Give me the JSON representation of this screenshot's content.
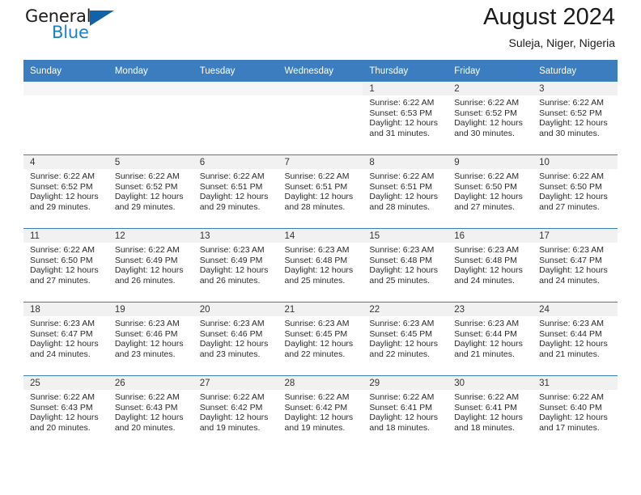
{
  "logo": {
    "primary_text": "General",
    "secondary_text": "Blue",
    "primary_color": "#1b1b1b",
    "secondary_color": "#1f7fc4",
    "triangle_color": "#1162a8"
  },
  "header": {
    "month_title": "August 2024",
    "location": "Suleja, Niger, Nigeria"
  },
  "colors": {
    "header_row_background": "#3b7dbf",
    "header_row_text": "#ffffff",
    "day_number_background": "#f1f1f1",
    "week_separator": "#3b7dbf"
  },
  "weekdays": [
    "Sunday",
    "Monday",
    "Tuesday",
    "Wednesday",
    "Thursday",
    "Friday",
    "Saturday"
  ],
  "weeks": [
    [
      {
        "day": "",
        "sunrise": "",
        "sunset": "",
        "daylight": ""
      },
      {
        "day": "",
        "sunrise": "",
        "sunset": "",
        "daylight": ""
      },
      {
        "day": "",
        "sunrise": "",
        "sunset": "",
        "daylight": ""
      },
      {
        "day": "",
        "sunrise": "",
        "sunset": "",
        "daylight": ""
      },
      {
        "day": "1",
        "sunrise": "Sunrise: 6:22 AM",
        "sunset": "Sunset: 6:53 PM",
        "daylight": "Daylight: 12 hours and 31 minutes."
      },
      {
        "day": "2",
        "sunrise": "Sunrise: 6:22 AM",
        "sunset": "Sunset: 6:52 PM",
        "daylight": "Daylight: 12 hours and 30 minutes."
      },
      {
        "day": "3",
        "sunrise": "Sunrise: 6:22 AM",
        "sunset": "Sunset: 6:52 PM",
        "daylight": "Daylight: 12 hours and 30 minutes."
      }
    ],
    [
      {
        "day": "4",
        "sunrise": "Sunrise: 6:22 AM",
        "sunset": "Sunset: 6:52 PM",
        "daylight": "Daylight: 12 hours and 29 minutes."
      },
      {
        "day": "5",
        "sunrise": "Sunrise: 6:22 AM",
        "sunset": "Sunset: 6:52 PM",
        "daylight": "Daylight: 12 hours and 29 minutes."
      },
      {
        "day": "6",
        "sunrise": "Sunrise: 6:22 AM",
        "sunset": "Sunset: 6:51 PM",
        "daylight": "Daylight: 12 hours and 29 minutes."
      },
      {
        "day": "7",
        "sunrise": "Sunrise: 6:22 AM",
        "sunset": "Sunset: 6:51 PM",
        "daylight": "Daylight: 12 hours and 28 minutes."
      },
      {
        "day": "8",
        "sunrise": "Sunrise: 6:22 AM",
        "sunset": "Sunset: 6:51 PM",
        "daylight": "Daylight: 12 hours and 28 minutes."
      },
      {
        "day": "9",
        "sunrise": "Sunrise: 6:22 AM",
        "sunset": "Sunset: 6:50 PM",
        "daylight": "Daylight: 12 hours and 27 minutes."
      },
      {
        "day": "10",
        "sunrise": "Sunrise: 6:22 AM",
        "sunset": "Sunset: 6:50 PM",
        "daylight": "Daylight: 12 hours and 27 minutes."
      }
    ],
    [
      {
        "day": "11",
        "sunrise": "Sunrise: 6:22 AM",
        "sunset": "Sunset: 6:50 PM",
        "daylight": "Daylight: 12 hours and 27 minutes."
      },
      {
        "day": "12",
        "sunrise": "Sunrise: 6:22 AM",
        "sunset": "Sunset: 6:49 PM",
        "daylight": "Daylight: 12 hours and 26 minutes."
      },
      {
        "day": "13",
        "sunrise": "Sunrise: 6:23 AM",
        "sunset": "Sunset: 6:49 PM",
        "daylight": "Daylight: 12 hours and 26 minutes."
      },
      {
        "day": "14",
        "sunrise": "Sunrise: 6:23 AM",
        "sunset": "Sunset: 6:48 PM",
        "daylight": "Daylight: 12 hours and 25 minutes."
      },
      {
        "day": "15",
        "sunrise": "Sunrise: 6:23 AM",
        "sunset": "Sunset: 6:48 PM",
        "daylight": "Daylight: 12 hours and 25 minutes."
      },
      {
        "day": "16",
        "sunrise": "Sunrise: 6:23 AM",
        "sunset": "Sunset: 6:48 PM",
        "daylight": "Daylight: 12 hours and 24 minutes."
      },
      {
        "day": "17",
        "sunrise": "Sunrise: 6:23 AM",
        "sunset": "Sunset: 6:47 PM",
        "daylight": "Daylight: 12 hours and 24 minutes."
      }
    ],
    [
      {
        "day": "18",
        "sunrise": "Sunrise: 6:23 AM",
        "sunset": "Sunset: 6:47 PM",
        "daylight": "Daylight: 12 hours and 24 minutes."
      },
      {
        "day": "19",
        "sunrise": "Sunrise: 6:23 AM",
        "sunset": "Sunset: 6:46 PM",
        "daylight": "Daylight: 12 hours and 23 minutes."
      },
      {
        "day": "20",
        "sunrise": "Sunrise: 6:23 AM",
        "sunset": "Sunset: 6:46 PM",
        "daylight": "Daylight: 12 hours and 23 minutes."
      },
      {
        "day": "21",
        "sunrise": "Sunrise: 6:23 AM",
        "sunset": "Sunset: 6:45 PM",
        "daylight": "Daylight: 12 hours and 22 minutes."
      },
      {
        "day": "22",
        "sunrise": "Sunrise: 6:23 AM",
        "sunset": "Sunset: 6:45 PM",
        "daylight": "Daylight: 12 hours and 22 minutes."
      },
      {
        "day": "23",
        "sunrise": "Sunrise: 6:23 AM",
        "sunset": "Sunset: 6:44 PM",
        "daylight": "Daylight: 12 hours and 21 minutes."
      },
      {
        "day": "24",
        "sunrise": "Sunrise: 6:23 AM",
        "sunset": "Sunset: 6:44 PM",
        "daylight": "Daylight: 12 hours and 21 minutes."
      }
    ],
    [
      {
        "day": "25",
        "sunrise": "Sunrise: 6:22 AM",
        "sunset": "Sunset: 6:43 PM",
        "daylight": "Daylight: 12 hours and 20 minutes."
      },
      {
        "day": "26",
        "sunrise": "Sunrise: 6:22 AM",
        "sunset": "Sunset: 6:43 PM",
        "daylight": "Daylight: 12 hours and 20 minutes."
      },
      {
        "day": "27",
        "sunrise": "Sunrise: 6:22 AM",
        "sunset": "Sunset: 6:42 PM",
        "daylight": "Daylight: 12 hours and 19 minutes."
      },
      {
        "day": "28",
        "sunrise": "Sunrise: 6:22 AM",
        "sunset": "Sunset: 6:42 PM",
        "daylight": "Daylight: 12 hours and 19 minutes."
      },
      {
        "day": "29",
        "sunrise": "Sunrise: 6:22 AM",
        "sunset": "Sunset: 6:41 PM",
        "daylight": "Daylight: 12 hours and 18 minutes."
      },
      {
        "day": "30",
        "sunrise": "Sunrise: 6:22 AM",
        "sunset": "Sunset: 6:41 PM",
        "daylight": "Daylight: 12 hours and 18 minutes."
      },
      {
        "day": "31",
        "sunrise": "Sunrise: 6:22 AM",
        "sunset": "Sunset: 6:40 PM",
        "daylight": "Daylight: 12 hours and 17 minutes."
      }
    ]
  ]
}
